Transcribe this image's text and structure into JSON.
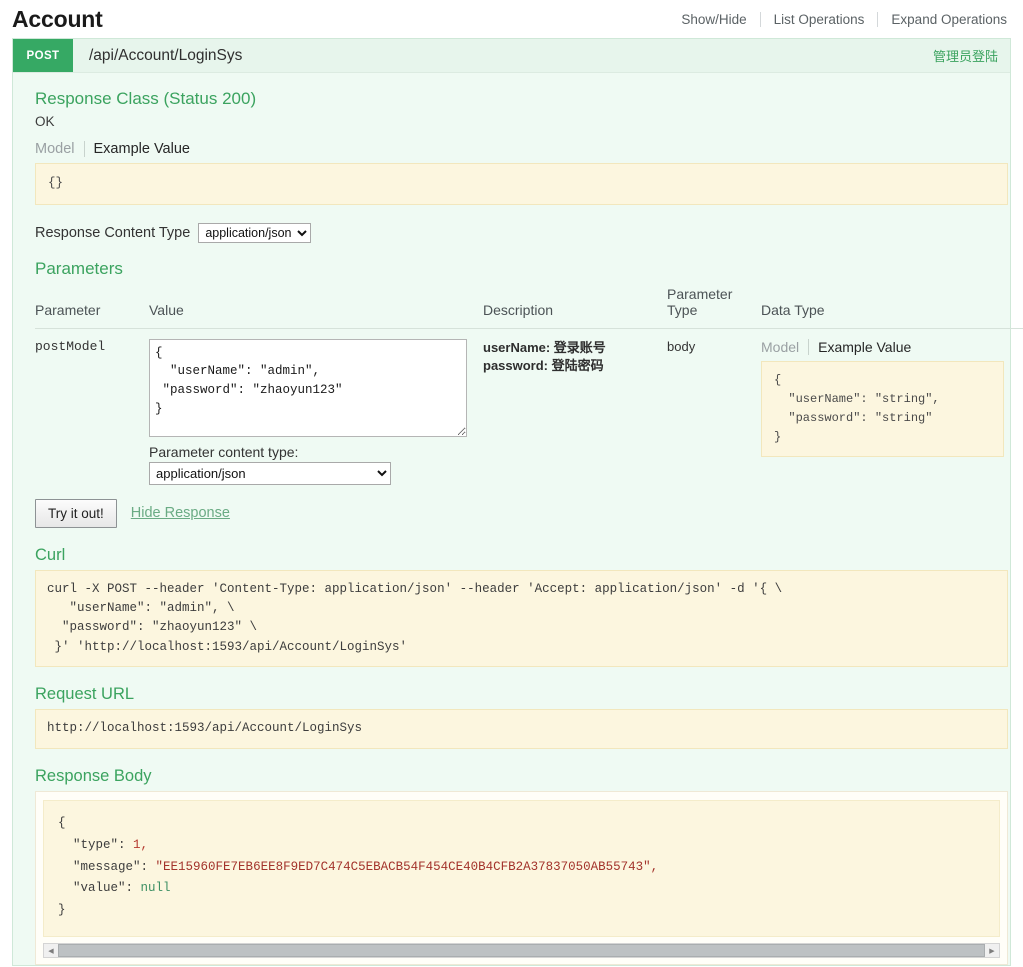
{
  "header": {
    "resource_title": "Account",
    "options": [
      "Show/Hide",
      "List Operations",
      "Expand Operations"
    ]
  },
  "operation": {
    "method": "POST",
    "path": "/api/Account/LoginSys",
    "summary": "管理员登陆"
  },
  "response_class": {
    "title": "Response Class (Status 200)",
    "status_text": "OK",
    "tab_model": "Model",
    "tab_example": "Example Value",
    "example_value": "{}",
    "content_type_label": "Response Content Type",
    "content_type_value": "application/json",
    "content_type_options": [
      "application/json"
    ]
  },
  "parameters": {
    "title": "Parameters",
    "columns": [
      "Parameter",
      "Value",
      "Description",
      "Parameter Type",
      "Data Type"
    ],
    "rows": [
      {
        "name": "postModel",
        "value": "{\n  \"userName\": \"admin\",\n \"password\": \"zhaoyun123\"\n}",
        "description_lines": [
          "userName: 登录账号",
          "password: 登陆密码"
        ],
        "param_type": "body",
        "data_type": {
          "tab_model": "Model",
          "tab_example": "Example Value",
          "example_value": "{\n  \"userName\": \"string\",\n  \"password\": \"string\"\n}"
        }
      }
    ],
    "content_type_label": "Parameter content type:",
    "content_type_value": "application/json",
    "content_type_options": [
      "application/json"
    ]
  },
  "actions": {
    "try_it_out": "Try it out!",
    "hide_response": "Hide Response"
  },
  "curl": {
    "title": "Curl",
    "command": "curl -X POST --header 'Content-Type: application/json' --header 'Accept: application/json' -d '{ \\\n   \"userName\": \"admin\", \\\n  \"password\": \"zhaoyun123\" \\\n }' 'http://localhost:1593/api/Account/LoginSys'"
  },
  "request_url": {
    "title": "Request URL",
    "url": "http://localhost:1593/api/Account/LoginSys"
  },
  "response_body": {
    "title": "Response Body",
    "json": {
      "open": "{",
      "type_key": "\"type\":",
      "type_value": "1,",
      "message_key": "\"message\":",
      "message_value": "\"EE15960FE7EB6EE8F9ED7C474C5EBACB54F454CE40B4CFB2A37837050AB55743\",",
      "value_key": "\"value\":",
      "value_value": "null",
      "close": "}"
    }
  },
  "colors": {
    "accent_green": "#3ba35f",
    "method_post": "#36a964",
    "code_bg": "#fcf6df",
    "panel_bg": "#effaf3"
  }
}
